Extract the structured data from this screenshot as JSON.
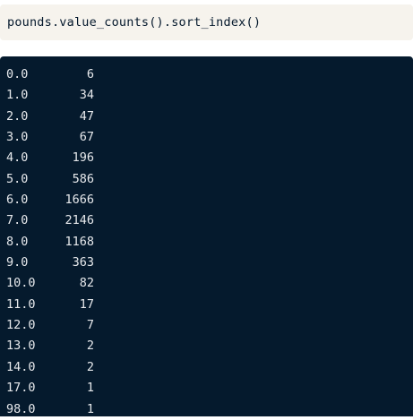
{
  "code_cell": {
    "code": "pounds.value_counts().sort_index()"
  },
  "output": {
    "rows": [
      {
        "index": "0.0",
        "count": "6"
      },
      {
        "index": "1.0",
        "count": "34"
      },
      {
        "index": "2.0",
        "count": "47"
      },
      {
        "index": "3.0",
        "count": "67"
      },
      {
        "index": "4.0",
        "count": "196"
      },
      {
        "index": "5.0",
        "count": "586"
      },
      {
        "index": "6.0",
        "count": "1666"
      },
      {
        "index": "7.0",
        "count": "2146"
      },
      {
        "index": "8.0",
        "count": "1168"
      },
      {
        "index": "9.0",
        "count": "363"
      },
      {
        "index": "10.0",
        "count": "82"
      },
      {
        "index": "11.0",
        "count": "17"
      },
      {
        "index": "12.0",
        "count": "7"
      },
      {
        "index": "13.0",
        "count": "2"
      },
      {
        "index": "14.0",
        "count": "2"
      },
      {
        "index": "17.0",
        "count": "1"
      },
      {
        "index": "98.0",
        "count": "1"
      }
    ]
  },
  "colors": {
    "code_background": "#f6f3ed",
    "code_text": "#05192d",
    "output_background": "#051a2d",
    "output_text": "#e7e9ec"
  }
}
